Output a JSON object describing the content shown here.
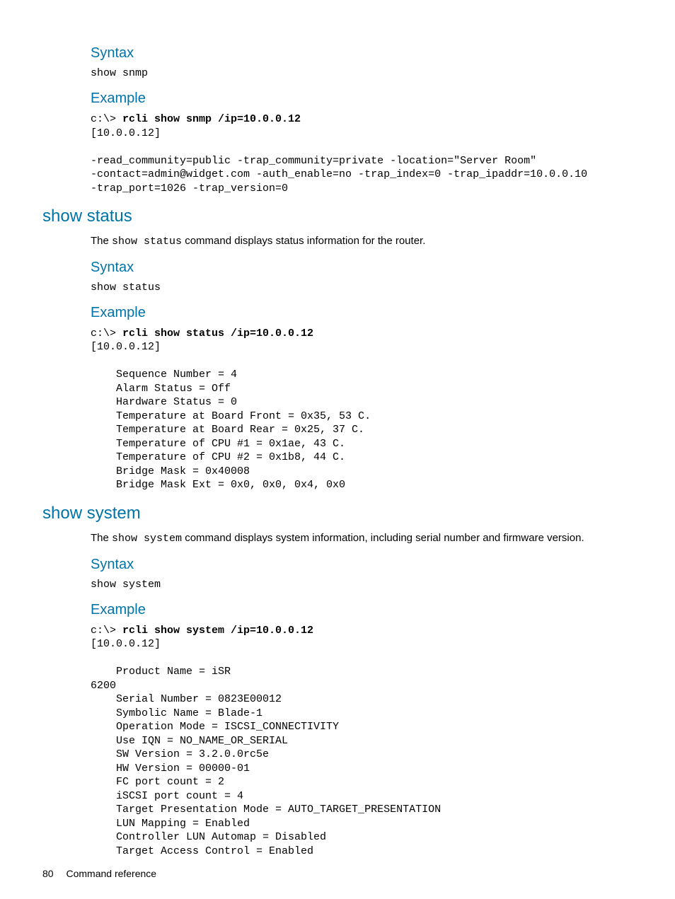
{
  "section1": {
    "syntax_heading": "Syntax",
    "syntax_cmd": "show snmp",
    "example_heading": "Example",
    "example_prefix": "c:\\> ",
    "example_bold": "rcli show snmp /ip=10.0.0.12",
    "example_body": "[10.0.0.12]\n\n-read_community=public -trap_community=private -location=\"Server Room\"\n-contact=admin@widget.com -auth_enable=no -trap_index=0 -trap_ipaddr=10.0.0.10\n-trap_port=1026 -trap_version=0"
  },
  "section2": {
    "title": "show status",
    "desc_pre": "The ",
    "desc_mono": "show status",
    "desc_post": " command displays status information for the router.",
    "syntax_heading": "Syntax",
    "syntax_cmd": "show status",
    "example_heading": "Example",
    "example_prefix": "c:\\> ",
    "example_bold": "rcli show status /ip=10.0.0.12",
    "example_body": "[10.0.0.12]\n\n    Sequence Number = 4\n    Alarm Status = Off\n    Hardware Status = 0\n    Temperature at Board Front = 0x35, 53 C.\n    Temperature at Board Rear = 0x25, 37 C.\n    Temperature of CPU #1 = 0x1ae, 43 C.\n    Temperature of CPU #2 = 0x1b8, 44 C.\n    Bridge Mask = 0x40008\n    Bridge Mask Ext = 0x0, 0x0, 0x4, 0x0"
  },
  "section3": {
    "title": "show system",
    "desc_pre": "The ",
    "desc_mono": "show system",
    "desc_post": " command displays system information, including serial number and firmware version.",
    "syntax_heading": "Syntax",
    "syntax_cmd": "show system",
    "example_heading": "Example",
    "example_prefix": "c:\\> ",
    "example_bold": "rcli show system /ip=10.0.0.12",
    "example_body": "[10.0.0.12]\n\n    Product Name = iSR\n6200\n    Serial Number = 0823E00012\n    Symbolic Name = Blade-1\n    Operation Mode = ISCSI_CONNECTIVITY\n    Use IQN = NO_NAME_OR_SERIAL\n    SW Version = 3.2.0.0rc5e\n    HW Version = 00000-01\n    FC port count = 2\n    iSCSI port count = 4\n    Target Presentation Mode = AUTO_TARGET_PRESENTATION\n    LUN Mapping = Enabled\n    Controller LUN Automap = Disabled\n    Target Access Control = Enabled"
  },
  "footer": {
    "page_number": "80",
    "section_name": "Command reference"
  }
}
